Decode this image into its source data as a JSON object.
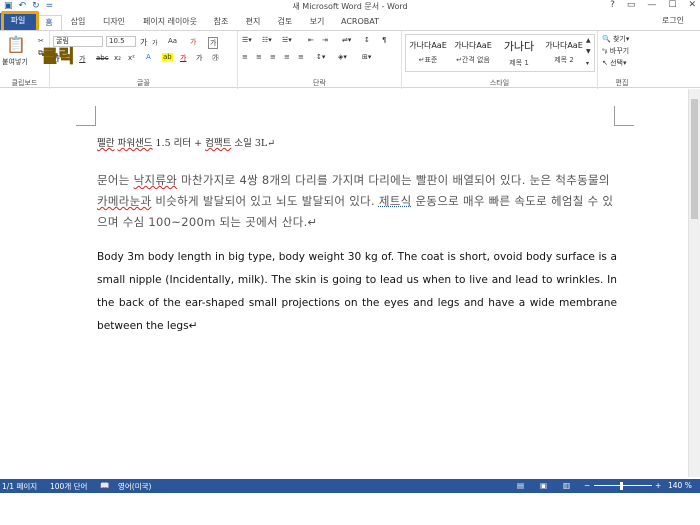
{
  "titlebar": {
    "title": "새 Microsoft Word 문서 - Word",
    "qat": [
      "▣",
      "↶",
      "↻",
      "="
    ],
    "help": "?",
    "restore": "▭",
    "minimize": "—",
    "maximize": "☐",
    "close": "✕"
  },
  "tabs": {
    "file": "파일",
    "home": "홈",
    "insert": "삽입",
    "design": "디자인",
    "layout": "페이지 레이아웃",
    "references": "참조",
    "mailings": "편지",
    "review": "검토",
    "view": "보기",
    "acrobat": "ACROBAT",
    "login": "로그인"
  },
  "annotation": {
    "click": "클릭"
  },
  "ribbon": {
    "clipboard": {
      "paste": "붙여넣기",
      "label": "클립보드"
    },
    "font": {
      "name": "굴림",
      "size": "10.5",
      "label": "글꼴",
      "grow": "가",
      "shrink": "가",
      "case": "Aa",
      "clear": "가",
      "bold": "가",
      "italic": "가",
      "underline": "가",
      "strike": "abc",
      "sub": "x₂",
      "sup": "x²"
    },
    "paragraph": {
      "label": "단락"
    },
    "styles": {
      "label": "스타일",
      "items": [
        {
          "sample": "가나다AaE",
          "name": "↵표준"
        },
        {
          "sample": "가나다AaE",
          "name": "↵간격 없음"
        },
        {
          "sample": "가나다",
          "name": "제목 1"
        },
        {
          "sample": "가나다AaE",
          "name": "제목 2"
        }
      ]
    },
    "editing": {
      "label": "편집",
      "find": "찾기",
      "replace": "바꾸기",
      "select": "선택"
    }
  },
  "document": {
    "line1": {
      "w1": "펠란",
      "w2": "파워샌드",
      "mid": " 1.5 리터 + ",
      "w3": "컴팩트",
      "end": " 소일 3L↵"
    },
    "kor": {
      "a": "문어는 ",
      "b": "낙지류와",
      "c": " 마찬가지로 4쌍 8개의 다리를 가지며 다리에는 빨판이 배열되어 있다. 눈은 척추동물의 ",
      "d": "카메라눈과",
      "e": " 비슷하게 발달되어 있고 뇌도 발달되어 있다. ",
      "f": "제트식",
      "g": " 운동으로 매우 빠른 속도로 헤엄칠 수 있으며 수심 100~200m 되는 곳에서 산다.↵"
    },
    "eng": "Body 3m body length in big type, body weight 30 kg of. The coat is short, ovoid body surface is a small nipple (Incidentally, milk). The skin is going to lead us when to live and lead to wrinkles. In the back of the ear-shaped small projections on the eyes and legs and have a wide membrane between the legs↵"
  },
  "status": {
    "page": "1/1 페이지",
    "words": "100개 단어",
    "lang": "영어(미국)",
    "zoom": "140 %",
    "zoom_level": 0.45
  },
  "colors": {
    "accent": "#2b579a",
    "highlight": "#e8a317",
    "annotation": "#f5c518"
  }
}
